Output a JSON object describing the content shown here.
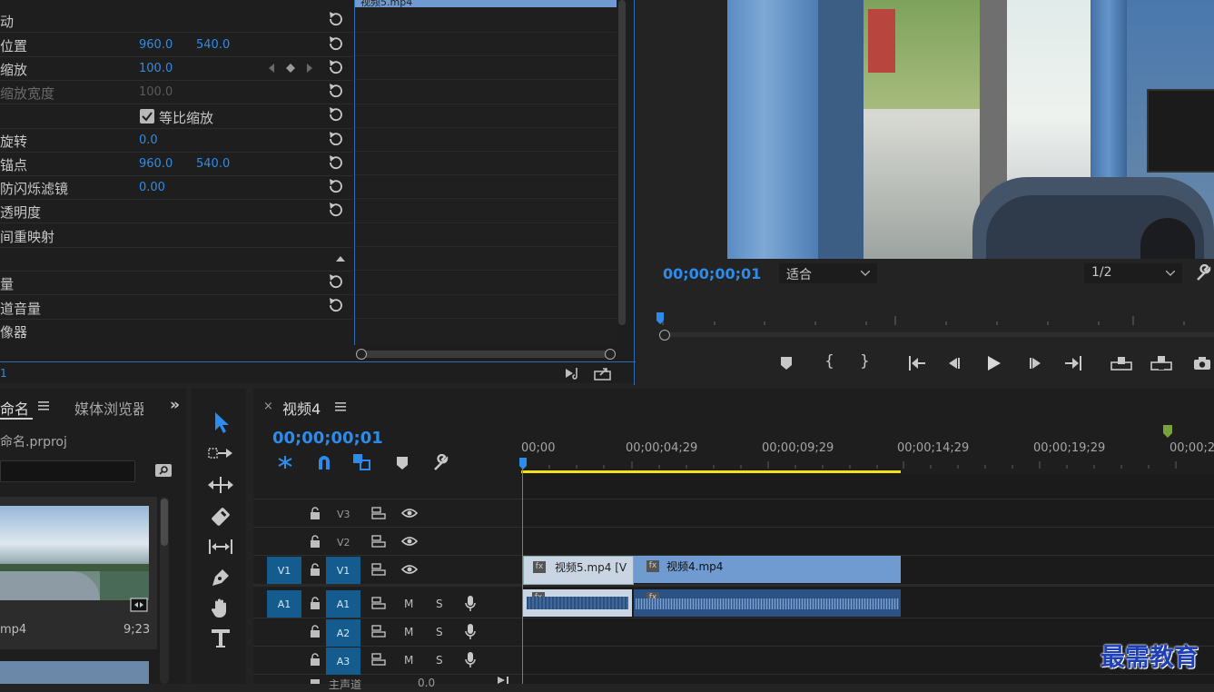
{
  "effects": {
    "rows": [
      {
        "label": "动",
        "v1": "",
        "v2": ""
      },
      {
        "label": "位置",
        "v1": "960.0",
        "v2": "540.0"
      },
      {
        "label": "缩放",
        "v1": "100.0",
        "v2": ""
      },
      {
        "label": "缩放宽度",
        "v1": "100.0",
        "v2": ""
      },
      {
        "label": "等比缩放",
        "v1": "",
        "v2": ""
      },
      {
        "label": "旋转",
        "v1": "0.0",
        "v2": ""
      },
      {
        "label": "锚点",
        "v1": "960.0",
        "v2": "540.0"
      },
      {
        "label": "防闪烁滤镜",
        "v1": "0.00",
        "v2": ""
      },
      {
        "label": "透明度",
        "v1": "",
        "v2": ""
      },
      {
        "label": "间重映射",
        "v1": "",
        "v2": ""
      },
      {
        "label": "",
        "v1": "",
        "v2": ""
      },
      {
        "label": "量",
        "v1": "",
        "v2": ""
      },
      {
        "label": "道音量",
        "v1": "",
        "v2": ""
      },
      {
        "label": "像器",
        "v1": "",
        "v2": ""
      }
    ],
    "clip_tab": "视频5.mp4",
    "bottom_time": "1"
  },
  "monitor": {
    "timecode": "00;00;00;01",
    "fit_select": "适合",
    "res_select": "1/2"
  },
  "project": {
    "tab_name": "命名",
    "tab_media": "媒体浏览器",
    "file_name": "命名.prproj",
    "thumb_name": "mp4",
    "thumb_dur": "9;23"
  },
  "timeline": {
    "tab_title": "视频4",
    "timecode": "00;00;00;01",
    "ruler": [
      "00;00",
      "00;00;04;29",
      "00;00;09;29",
      "00;00;14;29",
      "00;00;19;29",
      "00;00;2"
    ],
    "tracks": {
      "v3": "V3",
      "v2": "V2",
      "v1": "V1",
      "a1": "A1",
      "a2": "A2",
      "a3": "A3",
      "src_v1": "V1",
      "src_a1": "A1",
      "m": "M",
      "s": "S"
    },
    "clips": {
      "c1": "视频5.mp4 [V",
      "c2": "视频4.mp4"
    },
    "master": "主声道",
    "master_val": "0.0"
  },
  "watermark": "最需教育",
  "colors": {
    "accent": "#2d8ceb",
    "track_blue": "#155c8e",
    "clip_video": "#6f9bd0",
    "work_area": "#f2e01a"
  }
}
